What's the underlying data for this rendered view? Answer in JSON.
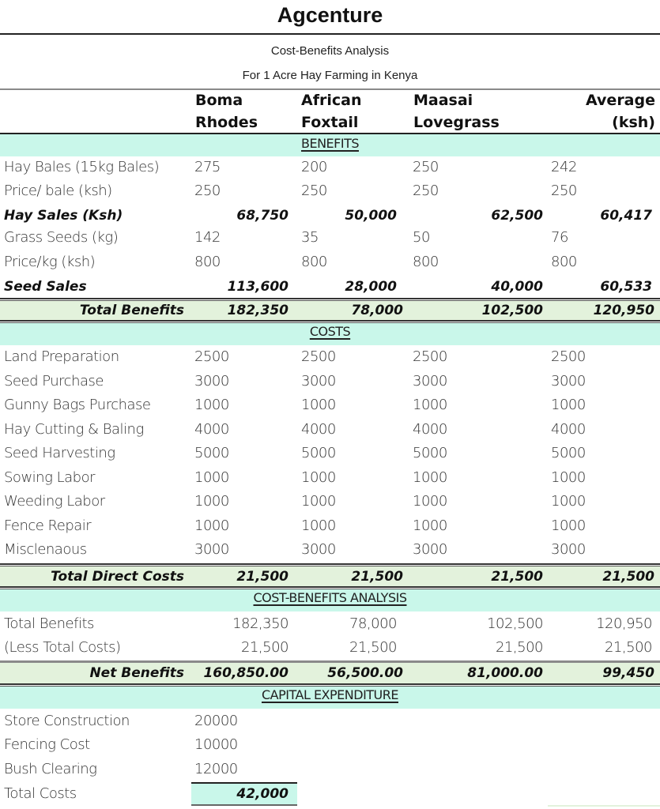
{
  "title": "Agcenture",
  "subtitle1": "Cost-Benefits Analysis",
  "subtitle2": "For 1 Acre Hay Farming in Kenya",
  "columns": [
    {
      "line1": "Boma",
      "line2": "Rhodes"
    },
    {
      "line1": "African",
      "line2": "Foxtail"
    },
    {
      "line1": "Maasai",
      "line2": "Lovegrass"
    },
    {
      "line1": "Average",
      "line2": "(ksh)"
    }
  ],
  "benefits": {
    "section_label": "BENEFITS",
    "rows": [
      {
        "label": "Hay Bales (15kg Bales)",
        "values": [
          "275",
          "200",
          "250",
          "242"
        ]
      },
      {
        "label": "Price/ bale (ksh)",
        "values": [
          "250",
          "250",
          "250",
          "250"
        ]
      },
      {
        "label": "Hay Sales (Ksh)",
        "values": [
          "68,750",
          "50,000",
          "62,500",
          "60,417"
        ],
        "bold": true
      },
      {
        "label": "Grass Seeds (kg)",
        "values": [
          "142",
          "35",
          "50",
          "76"
        ]
      },
      {
        "label": "Price/kg (ksh)",
        "values": [
          "800",
          "800",
          "800",
          "800"
        ]
      },
      {
        "label": "Seed Sales",
        "values": [
          "113,600",
          "28,000",
          "40,000",
          "60,533"
        ],
        "bold": true
      }
    ],
    "total": {
      "label": "Total Benefits",
      "values": [
        "182,350",
        "78,000",
        "102,500",
        "120,950"
      ]
    }
  },
  "costs": {
    "section_label": "COSTS",
    "rows": [
      {
        "label": "Land Preparation",
        "values": [
          "2500",
          "2500",
          "2500",
          "2500"
        ]
      },
      {
        "label": "Seed Purchase",
        "values": [
          "3000",
          "3000",
          "3000",
          "3000"
        ]
      },
      {
        "label": "Gunny Bags Purchase",
        "values": [
          "1000",
          "1000",
          "1000",
          "1000"
        ]
      },
      {
        "label": "Hay Cutting & Baling",
        "values": [
          "4000",
          "4000",
          "4000",
          "4000"
        ]
      },
      {
        "label": "Seed Harvesting",
        "values": [
          "5000",
          "5000",
          "5000",
          "5000"
        ]
      },
      {
        "label": "Sowing Labor",
        "values": [
          "1000",
          "1000",
          "1000",
          "1000"
        ]
      },
      {
        "label": "Weeding Labor",
        "values": [
          "1000",
          "1000",
          "1000",
          "1000"
        ]
      },
      {
        "label": "Fence Repair",
        "values": [
          "1000",
          "1000",
          "1000",
          "1000"
        ]
      },
      {
        "label": "Misclenaous",
        "values": [
          "3000",
          "3000",
          "3000",
          "3000"
        ]
      }
    ],
    "total": {
      "label": "Total Direct Costs",
      "values": [
        "21,500",
        "21,500",
        "21,500",
        "21,500"
      ]
    }
  },
  "analysis": {
    "section_label": "COST-BENEFITS ANALYSIS",
    "rows": [
      {
        "label": "Total Benefits",
        "values": [
          "182,350",
          "78,000",
          "102,500",
          "120,950"
        ]
      },
      {
        "label": "(Less Total Costs)",
        "values": [
          "21,500",
          "21,500",
          "21,500",
          "21,500"
        ]
      }
    ],
    "total": {
      "label": "Net Benefits",
      "values": [
        "160,850.00",
        "56,500.00",
        "81,000.00",
        "99,450"
      ]
    }
  },
  "capex": {
    "section_label": "CAPITAL EXPENDITURE",
    "rows": [
      {
        "label": "Store Construction",
        "value": "20000"
      },
      {
        "label": "Fencing Cost",
        "value": "10000"
      },
      {
        "label": "Bush Clearing",
        "value": "12000"
      }
    ],
    "total": {
      "label": "Total Costs",
      "value": "42,000"
    }
  }
}
